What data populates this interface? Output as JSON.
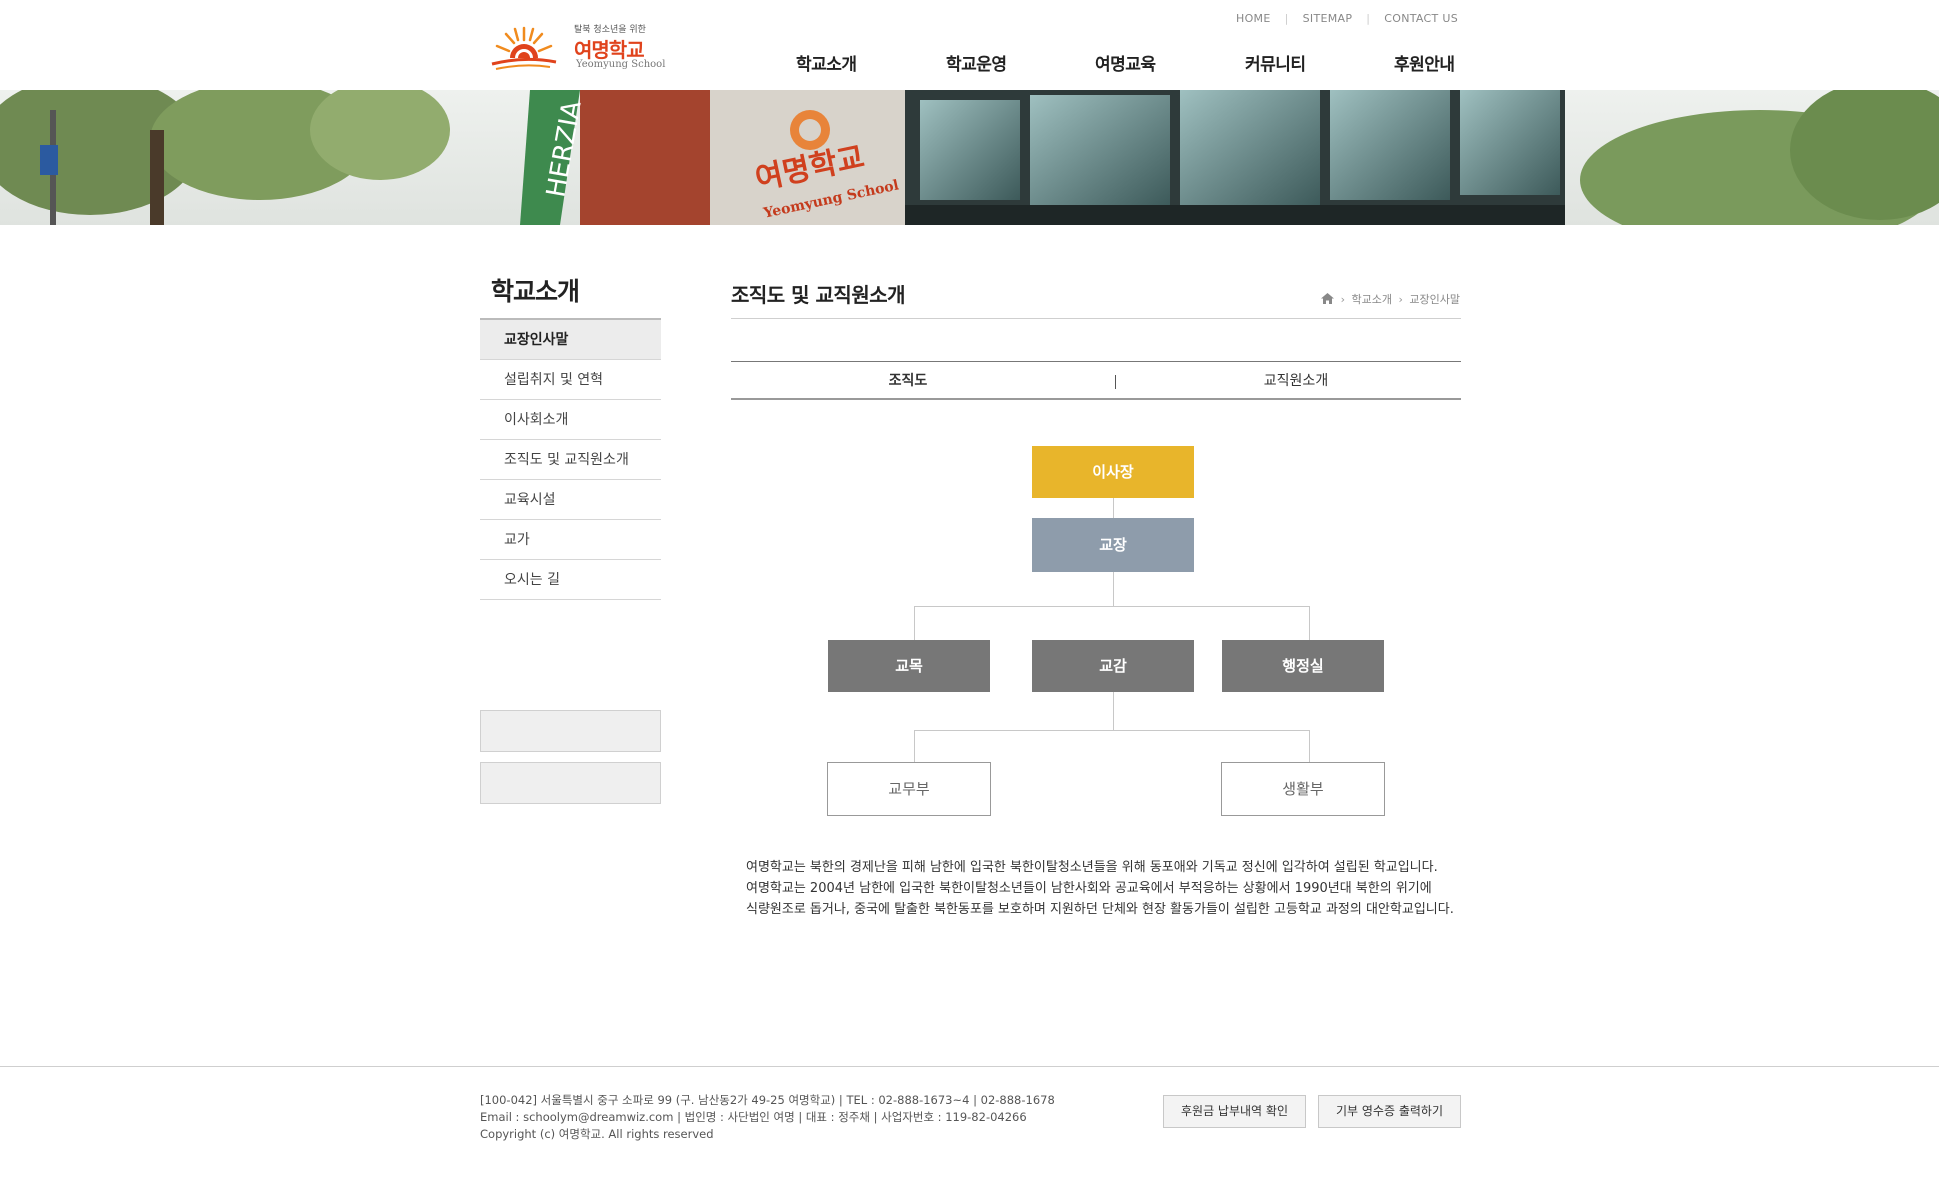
{
  "header": {
    "logo_tagline": "탈북 청소년을 위한",
    "logo_name": "여명학교",
    "logo_en": "Yeomyung School",
    "top_links": [
      "HOME",
      "SITEMAP",
      "CONTACT US"
    ],
    "nav": [
      "학교소개",
      "학교운영",
      "여명교육",
      "커뮤니티",
      "후원안내"
    ]
  },
  "banner": {
    "sign_ko": "여명학교",
    "sign_en": "Yeomyung School",
    "store_text": "HERZIA"
  },
  "sidebar": {
    "title": "학교소개",
    "items": [
      "교장인사말",
      "설립취지 및 연혁",
      "이사회소개",
      "조직도 및 교직원소개",
      "교육시설",
      "교가",
      "오시는 길"
    ],
    "active_index": 0
  },
  "content": {
    "title": "조직도 및 교직원소개",
    "breadcrumb": [
      "학교소개",
      "교장인사말"
    ],
    "tabs": [
      "조직도",
      "교직원소개"
    ],
    "active_tab": 0,
    "org": {
      "chairman": "이사장",
      "principal": "교장",
      "level2": [
        "교목",
        "교감",
        "행정실"
      ],
      "level3": [
        "교무부",
        "생활부"
      ],
      "colors": {
        "chairman": "#e8b52b",
        "principal": "#8e9cab",
        "level2": "#777777"
      }
    },
    "description": [
      "여명학교는 북한의 경제난을 피해 남한에 입국한 북한이탈청소년들을 위해 동포애와 기독교 정신에 입각하여 설립된 학교입니다.",
      "여명학교는 2004년 남한에 입국한 북한이탈청소년들이 남한사회와 공교육에서 부적응하는 상황에서 1990년대 북한의 위기에",
      "식량원조로 돕거나, 중국에 탈출한 북한동포를 보호하며 지원하던 단체와 현장 활동가들이 설립한 고등학교 과정의 대안학교입니다."
    ]
  },
  "footer": {
    "lines": [
      "[100-042] 서울특별시 중구 소파로 99 (구. 남산동2가 49-25 여명학교) | TEL : 02-888-1673~4 | 02-888-1678",
      "Email : schoolym@dreamwiz.com | 법인명 : 사단법인 여명 | 대표 : 정주채 | 사업자번호 : 119-82-04266",
      "Copyright (c) 여명학교. All rights reserved"
    ],
    "buttons": [
      "후원금 납부내역 확인",
      "기부 영수증 출력하기"
    ]
  }
}
